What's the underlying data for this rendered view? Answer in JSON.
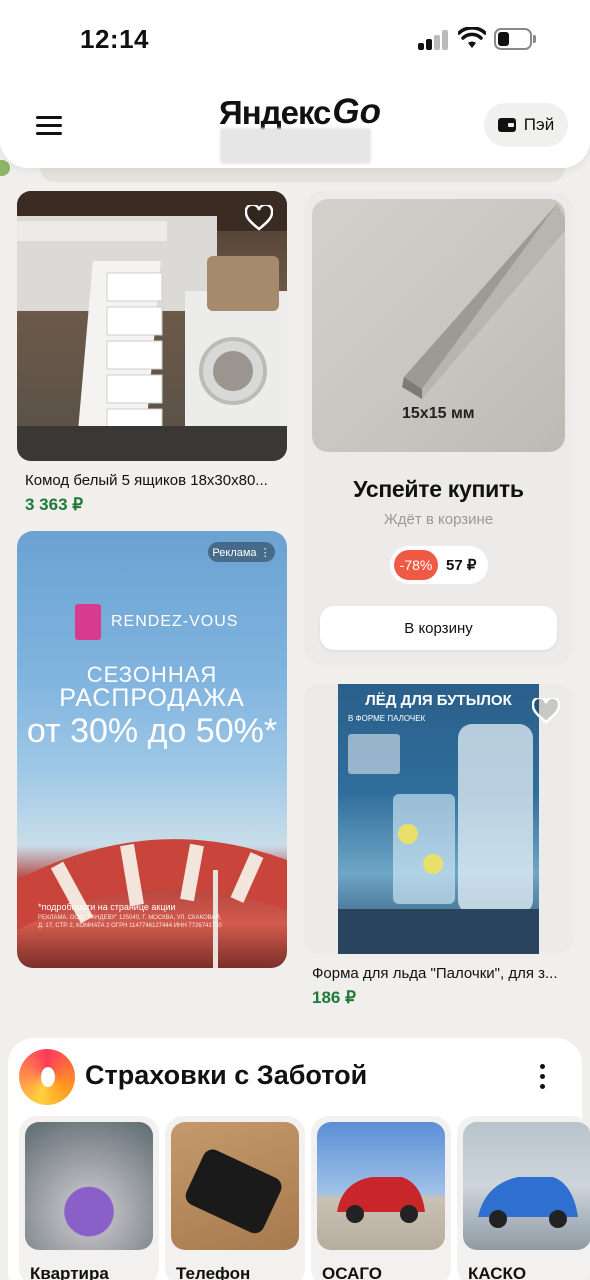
{
  "status": {
    "time": "12:14"
  },
  "header": {
    "logo_text": "Яндекс",
    "logo_go": "Go",
    "pay_label": "Пэй"
  },
  "products": [
    {
      "title": "Комод белый 5 ящиков 18x30x80...",
      "price": "3 363 ₽"
    },
    {
      "title": "Форма для льда \"Палочки\", для з...",
      "price": "186 ₽"
    }
  ],
  "promo": {
    "dimension": "15x15 мм",
    "title": "Успейте купить",
    "subtitle": "Ждёт в корзине",
    "discount": "-78%",
    "price": "57 ₽",
    "button": "В корзину"
  },
  "ad": {
    "badge": "Реклама ⋮",
    "brand": "RENDEZ-VOUS",
    "line1": "СЕЗОННАЯ",
    "line2": "РАСПРОДАЖА",
    "line3": "от 30% до 50%*",
    "note": "*подробности на странице акции",
    "legal": "РЕКЛАМА. ООО \"РАНДЕВУ\" 125040, Г. МОСКВА, УЛ. СКАКОВАЯ, Д. 17, СТР. 2, КОМНАТА 2 ОГРН 1147746127444 ИНН 7726741730"
  },
  "ice": {
    "headline": "ЛЁД ДЛЯ БУТЫЛОК",
    "subline": "В ФОРМЕ ПАЛОЧЕК"
  },
  "insurance": {
    "title": "Страховки с Заботой",
    "items": [
      {
        "label": "Квартира"
      },
      {
        "label": "Телефон"
      },
      {
        "label": "ОСАГО"
      },
      {
        "label": "КАСКО"
      }
    ]
  },
  "colors": {
    "price_green": "#1f7a3a",
    "discount_red": "#f05a45"
  }
}
